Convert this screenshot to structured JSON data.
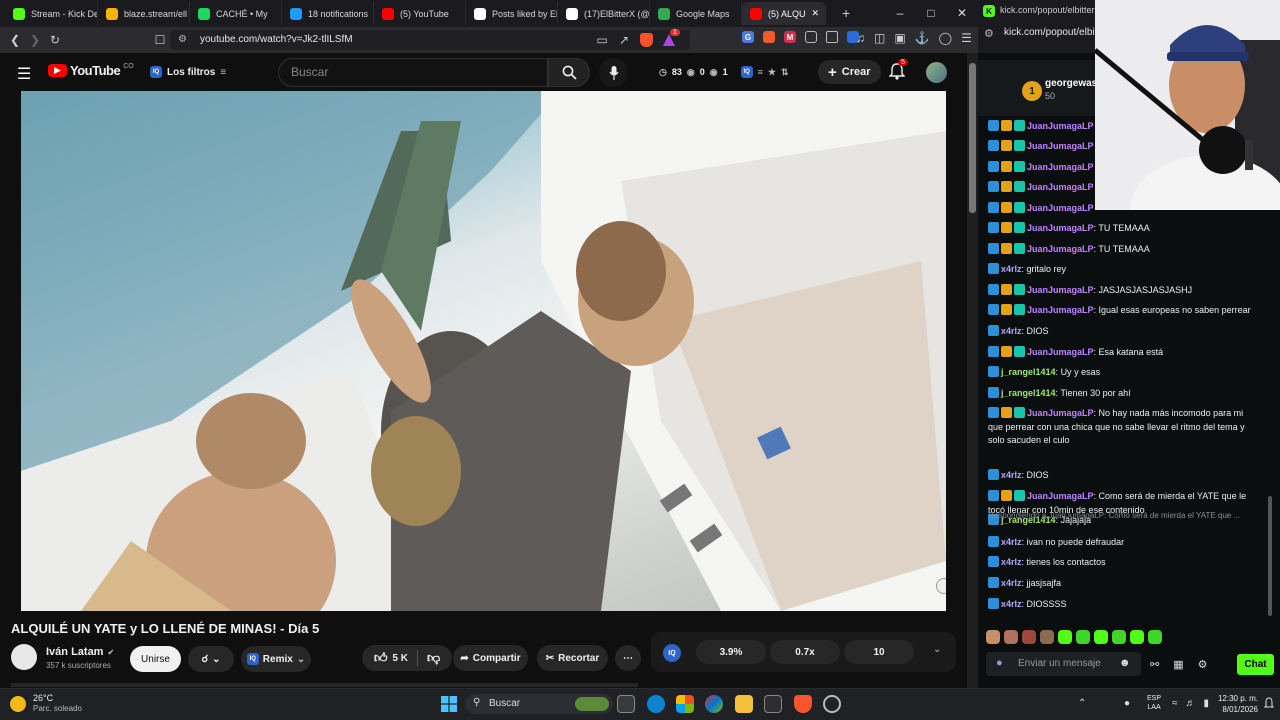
{
  "browser": {
    "tabs": [
      {
        "label": "Stream - Kick De",
        "icon": "kick-icon",
        "color": "#53fc18"
      },
      {
        "label": "blaze.stream/ell",
        "icon": "page-icon",
        "color": "#f7b500"
      },
      {
        "label": "CACHÉ • My",
        "icon": "spotify-icon",
        "color": "#1ed760"
      },
      {
        "label": "18 notifications",
        "icon": "notifications-icon",
        "color": "#1d9bf0"
      },
      {
        "label": "(5) YouTube",
        "icon": "youtube-icon",
        "color": "#ff0000"
      },
      {
        "label": "Posts liked by El",
        "icon": "x-icon",
        "color": "#ffffff"
      },
      {
        "label": "(17)ElBitterX (@e",
        "icon": "tiktok-icon",
        "color": "#ffffff"
      },
      {
        "label": "Google Maps",
        "icon": "maps-icon",
        "color": "#34a853"
      },
      {
        "label": "(5) ALQU",
        "icon": "youtube-icon",
        "color": "#ff0000"
      }
    ],
    "new_tab": "+",
    "url": "youtube.com/watch?v=Jk2-tlILSfM",
    "brave_badge": "1"
  },
  "youtube": {
    "logo_text": "YouTube",
    "country": "CO",
    "filters_label": "Los filtros",
    "search_placeholder": "Buscar",
    "ext_stats": {
      "a": "83",
      "b": "0",
      "c": "1"
    },
    "create_label": "Crear",
    "notif_count": "5",
    "video_title": "ALQUILÉ UN YATE y LO LLENÉ DE MINAS! - Día 5",
    "channel": {
      "name": "Iván Latam",
      "subs": "357 k suscriptores"
    },
    "join_label": "Unirse",
    "remix_label": "Remix",
    "likes": "5 K",
    "share_label": "Compartir",
    "clip_label": "Recortar",
    "stats": {
      "a": "3.9%",
      "b": "0.7x",
      "c": "10"
    }
  },
  "chat": {
    "popout_url": "kick.com/popout/elbitterx/c",
    "top_user": {
      "rank": "1",
      "name": "georgewas",
      "points": "50"
    },
    "messages": [
      {
        "user": "JuanJumagaLP",
        "text": "",
        "color": "#c082ff",
        "badges": [
          "blue",
          "gold",
          "teal"
        ]
      },
      {
        "user": "JuanJumagaLP",
        "text": "",
        "color": "#c082ff",
        "badges": [
          "blue",
          "gold",
          "teal"
        ]
      },
      {
        "user": "JuanJumagaLP",
        "text": "",
        "color": "#c082ff",
        "badges": [
          "blue",
          "gold",
          "teal"
        ]
      },
      {
        "user": "JuanJumagaLP",
        "text": "",
        "color": "#c082ff",
        "badges": [
          "blue",
          "gold",
          "teal"
        ]
      },
      {
        "user": "JuanJumagaLP",
        "text": "",
        "color": "#c082ff",
        "badges": [
          "blue",
          "gold",
          "teal"
        ]
      },
      {
        "user": "JuanJumagaLP",
        "text": "TU TEMAAA",
        "color": "#c082ff",
        "badges": [
          "blue",
          "gold",
          "teal"
        ]
      },
      {
        "user": "JuanJumagaLP",
        "text": "TU TEMAAA",
        "color": "#c082ff",
        "badges": [
          "blue",
          "gold",
          "teal"
        ]
      },
      {
        "user": "x4rlz",
        "text": "gritalo rey",
        "color": "#b6a6ff",
        "badges": [
          "blue"
        ]
      },
      {
        "user": "JuanJumagaLP",
        "text": "JASJASJASJASJASHJ",
        "color": "#c082ff",
        "badges": [
          "blue",
          "gold",
          "teal"
        ]
      },
      {
        "user": "JuanJumagaLP",
        "text": "Igual esas europeas no saben perrear",
        "color": "#c082ff",
        "badges": [
          "blue",
          "gold",
          "teal"
        ]
      },
      {
        "user": "x4rlz",
        "text": "DIOS",
        "color": "#b6a6ff",
        "badges": [
          "blue"
        ]
      },
      {
        "user": "JuanJumagaLP",
        "text": "Esa katana está",
        "color": "#c082ff",
        "badges": [
          "blue",
          "gold",
          "teal"
        ]
      },
      {
        "user": "j_rangel1414",
        "text": "Uy y esas",
        "color": "#9fe870",
        "badges": [
          "blue"
        ]
      },
      {
        "user": "j_rangel1414",
        "text": "Tienen 30 por ahí",
        "color": "#9fe870",
        "badges": [
          "blue"
        ]
      },
      {
        "user": "JuanJumagaLP",
        "text": "No hay nada más incomodo para mi que perrear con una chica que no sabe llevar el ritmo del tema y solo sacuden el culo",
        "color": "#c082ff",
        "badges": [
          "blue",
          "gold",
          "teal"
        ]
      },
      {
        "user": "x4rlz",
        "text": "DIOS",
        "color": "#b6a6ff",
        "badges": [
          "blue"
        ]
      },
      {
        "user": "JuanJumagaLP",
        "text": "Como será de mierda el YATE que le tocó llenar con 10min de ese contenido",
        "color": "#c082ff",
        "badges": [
          "blue",
          "gold",
          "teal"
        ]
      },
      {
        "user": "j_rangel1414",
        "text": "Jajajaja",
        "color": "#9fe870",
        "badges": [
          "blue"
        ]
      },
      {
        "user": "x4rlz",
        "text": "ivan no puede defraudar",
        "color": "#b6a6ff",
        "badges": [
          "blue"
        ]
      },
      {
        "user": "x4rlz",
        "text": "tienes los contactos",
        "color": "#b6a6ff",
        "badges": [
          "blue"
        ]
      },
      {
        "user": "x4rlz",
        "text": "jjasjsajfa",
        "color": "#b6a6ff",
        "badges": [
          "blue"
        ]
      },
      {
        "user": "x4rlz",
        "text": "DIOSSSS",
        "color": "#b6a6ff",
        "badges": [
          "blue"
        ]
      }
    ],
    "reply_note": "Respondiendo a JuanJumagaLP: Como será de mierda el YATE que ...",
    "input_placeholder": "Enviar un mensaje",
    "chat_button": "Chat",
    "accent": "#53fc18"
  },
  "taskbar": {
    "weather_temp": "26°C",
    "weather_desc": "Parc. soleado",
    "search_label": "Buscar",
    "lang": "ESP",
    "region": "LAA",
    "time": "12:30 p. m.",
    "date": "8/01/2026"
  }
}
